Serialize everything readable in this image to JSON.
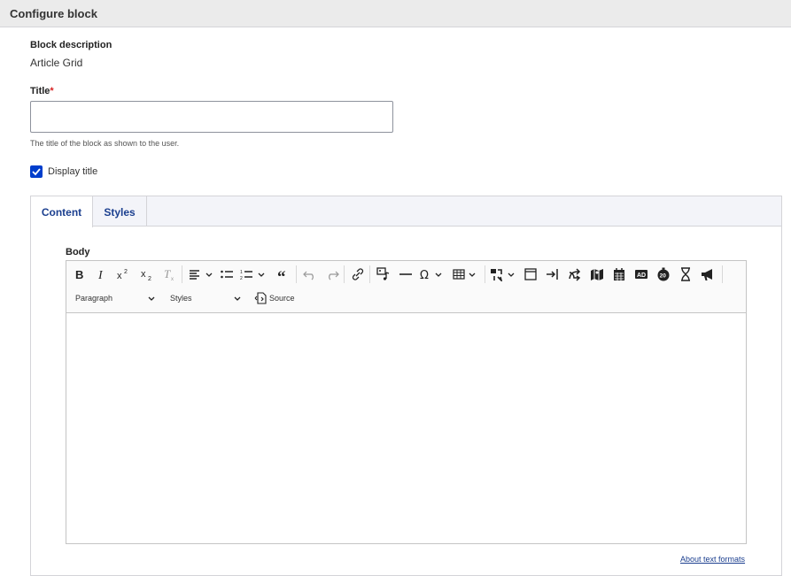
{
  "dialog": {
    "title": "Configure block"
  },
  "form": {
    "block_description_label": "Block description",
    "block_description_value": "Article Grid",
    "title_label": "Title",
    "title_required_marker": "*",
    "title_value": "",
    "title_description": "The title of the block as shown to the user.",
    "display_title_label": "Display title",
    "display_title_checked": true
  },
  "tabs": [
    {
      "label": "Content",
      "active": true
    },
    {
      "label": "Styles",
      "active": false
    }
  ],
  "editor": {
    "body_label": "Body",
    "toolbar_row1_icons": [
      "bold-icon",
      "italic-icon",
      "superscript-icon",
      "subscript-icon",
      "remove-format-icon",
      "align-icon",
      "bulleted-list-icon",
      "numbered-list-icon",
      "blockquote-icon",
      "undo-icon",
      "redo-icon",
      "link-icon",
      "media-icon",
      "horizontal-line-icon",
      "special-characters-icon",
      "table-icon",
      "embed-icon",
      "box-icon",
      "arrow-in-icon",
      "share-icon",
      "map-icon",
      "calendar-icon",
      "ad-icon",
      "timer-icon",
      "hourglass-icon",
      "megaphone-icon"
    ],
    "paragraph_select": "Paragraph",
    "styles_select": "Styles",
    "source_label": "Source",
    "content": ""
  },
  "footer": {
    "about_text_formats": "About text formats"
  },
  "colors": {
    "accent": "#003ecc",
    "link": "#1b3f8f",
    "required": "#d72222"
  }
}
